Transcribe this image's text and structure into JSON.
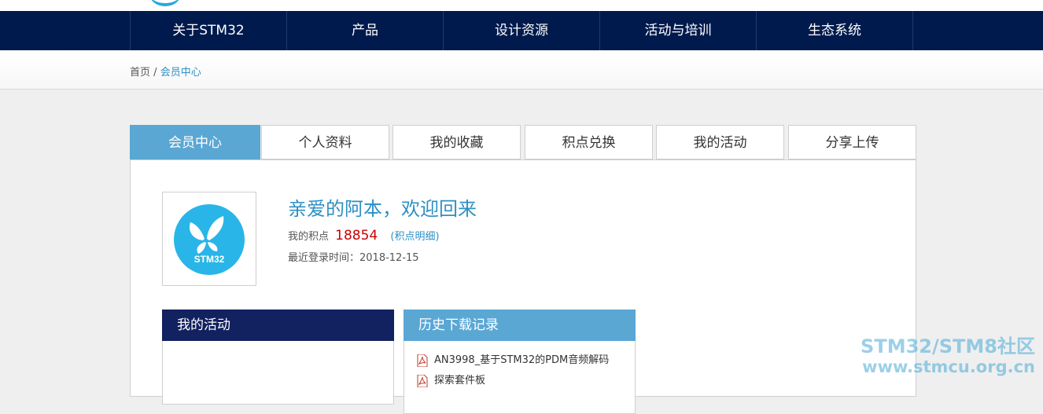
{
  "nav": {
    "items": [
      {
        "label": "关于STM32"
      },
      {
        "label": "产品"
      },
      {
        "label": "设计资源"
      },
      {
        "label": "活动与培训"
      },
      {
        "label": "生态系统"
      }
    ]
  },
  "breadcrumb": {
    "home": "首页",
    "separator": "/",
    "current": "会员中心"
  },
  "tabs": [
    {
      "label": "会员中心",
      "active": true
    },
    {
      "label": "个人资料"
    },
    {
      "label": "我的收藏"
    },
    {
      "label": "积点兑换"
    },
    {
      "label": "我的活动"
    },
    {
      "label": "分享上传"
    }
  ],
  "profile": {
    "avatar_text": "STM32",
    "welcome": "亲爱的阿本，欢迎回来",
    "points_label": "我的积点",
    "points_value": "18854",
    "points_link": "(积点明细)",
    "last_login_label": "最近登录时间：",
    "last_login": "2018-12-15"
  },
  "activities": {
    "title": "我的活动"
  },
  "downloads": {
    "title": "历史下载记录",
    "items": [
      {
        "name": "AN3998_基于STM32的PDM音频解码"
      },
      {
        "name": "探索套件板"
      }
    ]
  },
  "watermark": {
    "line1": "STM32/STM8社区",
    "line2": "www.stmcu.org.cn"
  },
  "colors": {
    "nav_bg": "#001a4d",
    "accent": "#5aa7d4",
    "link": "#2e8fc4",
    "points": "#cc0000",
    "activity_head": "#12215f"
  }
}
